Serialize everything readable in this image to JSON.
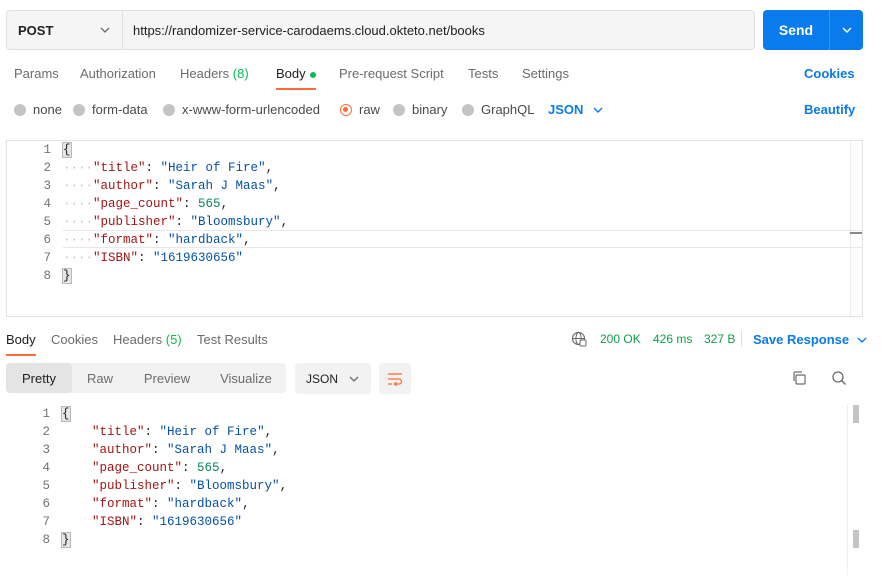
{
  "request": {
    "method": "POST",
    "url": "https://randomizer-service-carodaems.cloud.okteto.net/books",
    "send_label": "Send"
  },
  "request_tabs": {
    "params": "Params",
    "authorization": "Authorization",
    "headers": "Headers",
    "headers_count": "(8)",
    "body": "Body",
    "pre_request": "Pre-request Script",
    "tests": "Tests",
    "settings": "Settings",
    "cookies": "Cookies"
  },
  "body_types": {
    "none": "none",
    "form_data": "form-data",
    "urlencoded": "x-www-form-urlencoded",
    "raw": "raw",
    "binary": "binary",
    "graphql": "GraphQL",
    "language": "JSON",
    "beautify": "Beautify"
  },
  "request_body": {
    "lines": [
      "1",
      "2",
      "3",
      "4",
      "5",
      "6",
      "7",
      "8"
    ],
    "title_key": "\"title\"",
    "title_val": "\"Heir of Fire\"",
    "author_key": "\"author\"",
    "author_val": "\"Sarah J Maas\"",
    "page_key": "\"page_count\"",
    "page_val": "565",
    "publisher_key": "\"publisher\"",
    "publisher_val": "\"Bloomsbury\"",
    "format_key": "\"format\"",
    "format_val": "\"hardback\"",
    "isbn_key": "\"ISBN\"",
    "isbn_val": "\"1619630656\""
  },
  "response_tabs": {
    "body": "Body",
    "cookies": "Cookies",
    "headers": "Headers",
    "headers_count": "(5)",
    "test_results": "Test Results"
  },
  "response_status": {
    "status": "200 OK",
    "time": "426 ms",
    "size": "327 B",
    "save_response": "Save Response"
  },
  "response_view": {
    "pretty": "Pretty",
    "raw": "Raw",
    "preview": "Preview",
    "visualize": "Visualize",
    "format": "JSON"
  },
  "colors": {
    "accent": "#ff6c37",
    "primary": "#097bed",
    "success": "#0cbb52"
  }
}
